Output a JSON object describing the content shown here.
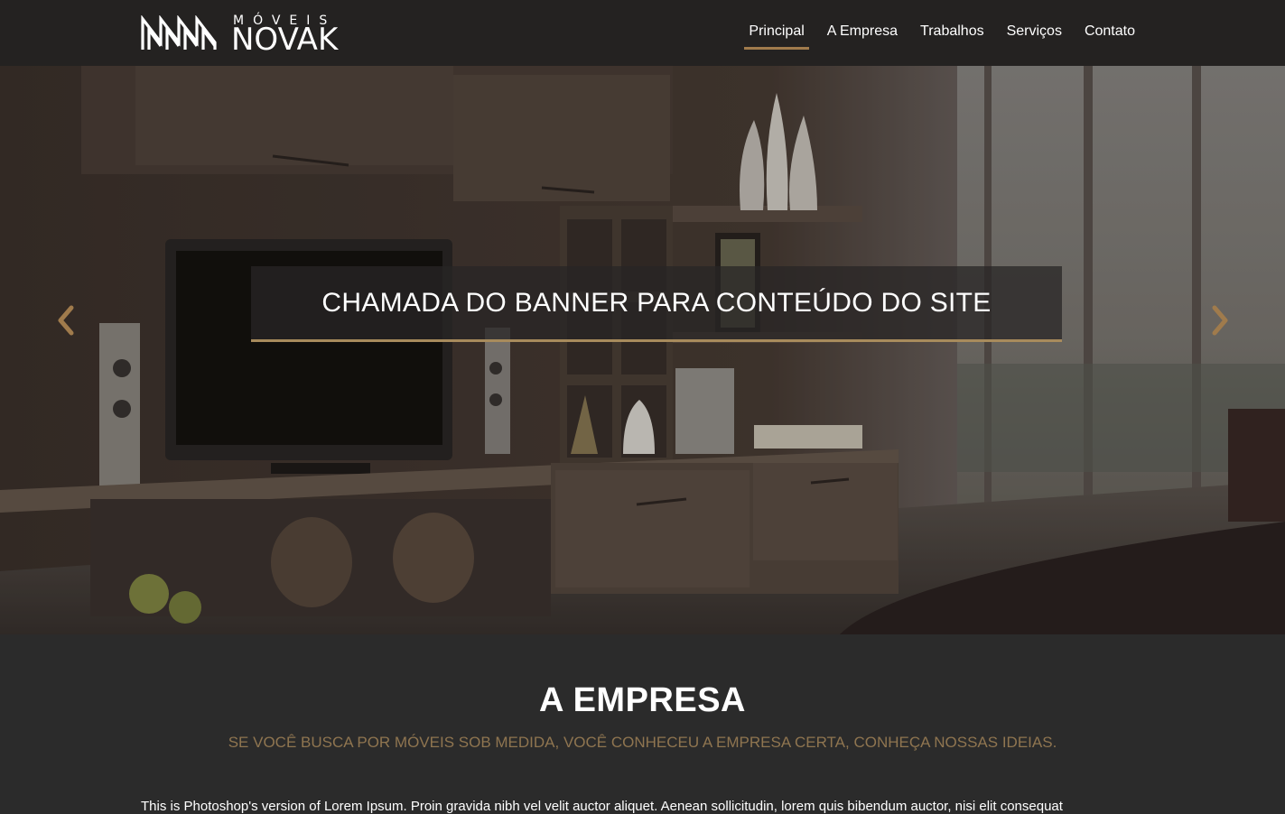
{
  "brand": {
    "top": "MÓVEIS",
    "name": "NOVAK"
  },
  "nav": {
    "items": [
      {
        "label": "Principal",
        "active": true
      },
      {
        "label": "A Empresa",
        "active": false
      },
      {
        "label": "Trabalhos",
        "active": false
      },
      {
        "label": "Serviços",
        "active": false
      },
      {
        "label": "Contato",
        "active": false
      }
    ]
  },
  "hero": {
    "banner_text": "CHAMADA DO BANNER PARA CONTEÚDO DO SITE",
    "prev_icon": "chevron-left-icon",
    "next_icon": "chevron-right-icon"
  },
  "empresa": {
    "title": "A EMPRESA",
    "subtitle": "SE VOCÊ BUSCA POR MÓVEIS SOB MEDIDA, VOCÊ CONHECEU A EMPRESA CERTA, CONHEÇA NOSSAS IDEIAS.",
    "body": "This is Photoshop's version of Lorem Ipsum. Proin gravida nibh vel velit auctor aliquet. Aenean sollicitudin, lorem quis bibendum auctor, nisi elit consequat"
  },
  "colors": {
    "accent": "#a07b4c",
    "header_bg": "#242221",
    "section_bg": "#2b2b2b",
    "subtitle": "#8f7550"
  }
}
